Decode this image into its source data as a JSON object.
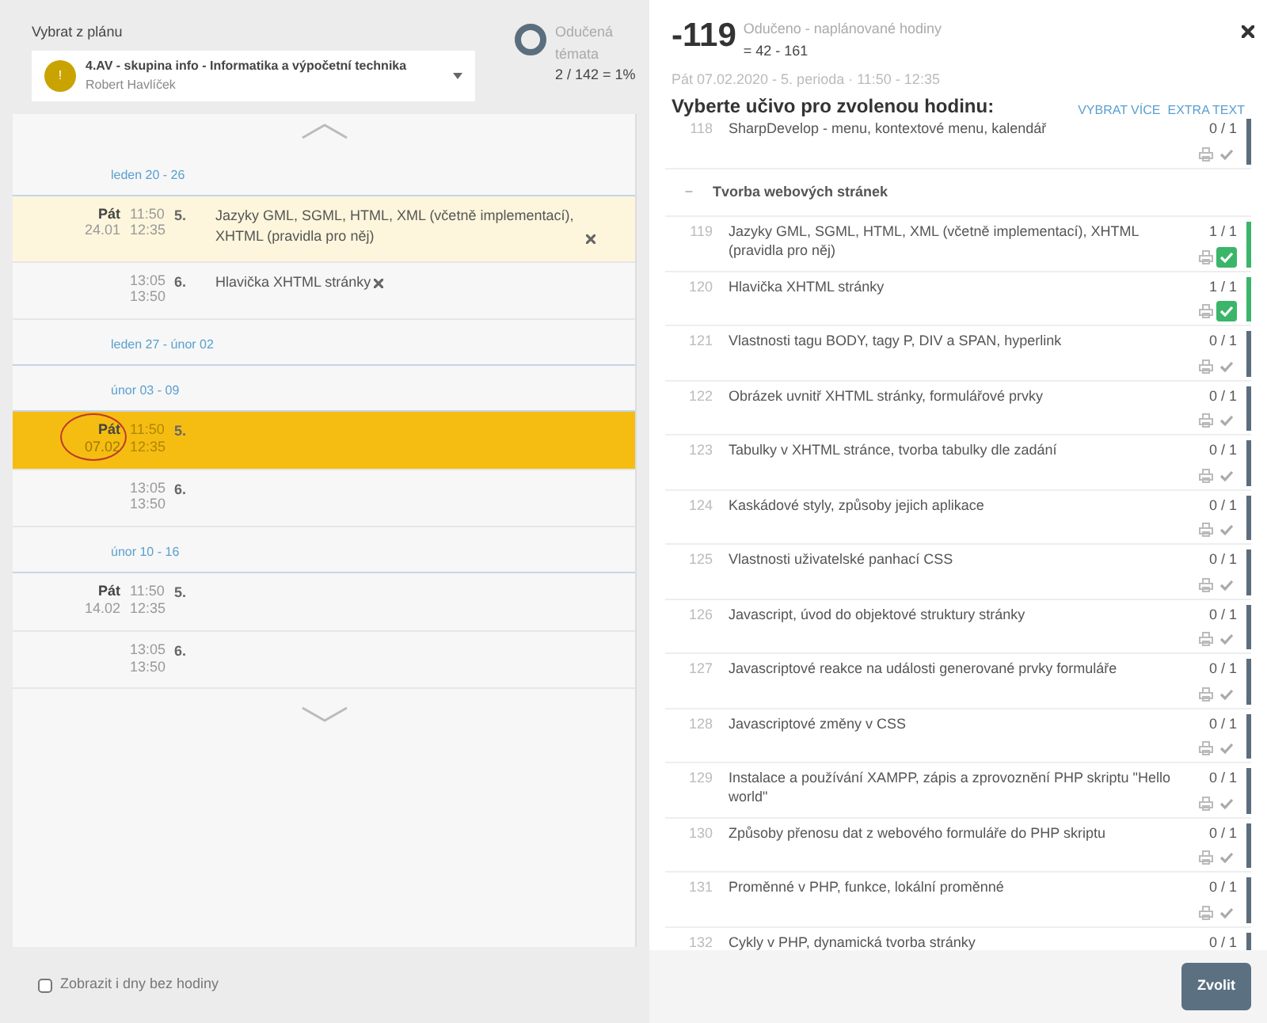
{
  "left": {
    "plan_label": "Vybrat z plánu",
    "plan_select": {
      "badge": "!",
      "title": "4.AV - skupina info - Informatika a výpočetní technika",
      "teacher": "Robert Havlíček"
    },
    "progress": {
      "label": "Odučená témata",
      "value": "2 / 142 = 1%"
    },
    "weeks": [
      {
        "label": "leden 20 - 26",
        "lessons": [
          {
            "day": "Pát",
            "date": "24.01",
            "start": "11:50",
            "end": "12:35",
            "period": "5.",
            "topic": "Jazyky GML, SGML, HTML, XML (včetně implementací), XHTML (pravidla pro něj)",
            "selected": false,
            "highlighted": true,
            "circled": false
          },
          {
            "start": "13:05",
            "end": "13:50",
            "period": "6.",
            "topic": "Hlavička XHTML stránky",
            "selected": false,
            "highlighted": false,
            "circled": false
          }
        ]
      },
      {
        "label": "leden 27 - únor 02"
      },
      {
        "label": "únor 03 - 09",
        "lessons": [
          {
            "day": "Pát",
            "date": "07.02",
            "start": "11:50",
            "end": "12:35",
            "period": "5.",
            "selected": true,
            "highlighted": false,
            "circled": true
          },
          {
            "start": "13:05",
            "end": "13:50",
            "period": "6.",
            "selected": false,
            "highlighted": false,
            "circled": false
          }
        ]
      },
      {
        "label": "únor 10 - 16",
        "lessons": [
          {
            "day": "Pát",
            "date": "14.02",
            "start": "11:50",
            "end": "12:35",
            "period": "5.",
            "selected": false,
            "highlighted": false,
            "circled": false
          },
          {
            "start": "13:05",
            "end": "13:50",
            "period": "6.",
            "selected": false,
            "highlighted": false,
            "circled": false
          }
        ]
      }
    ],
    "show_empty_days": {
      "label": "Zobrazit i dny bez hodiny",
      "checked": false
    }
  },
  "right": {
    "balance": "-119",
    "balance_label": "Odučeno - naplánované hodiny",
    "balance_formula": "= 42 - 161",
    "lesson_info": "Pát 07.02.2020 - 5. perioda · 11:50 - 12:35",
    "heading": "Vyberte učivo pro zvolenou hodinu:",
    "links": [
      "VYBRAT VÍCE",
      "EXTRA TEXT"
    ],
    "topics": [
      {
        "kind": "topic",
        "number": "118",
        "text": "SharpDevelop - menu, kontextové menu, kalendář",
        "count": "0 / 1",
        "done": false
      },
      {
        "kind": "section",
        "toggle": "−",
        "text": "Tvorba webových stránek"
      },
      {
        "kind": "topic",
        "number": "119",
        "text": "Jazyky GML, SGML, HTML, XML (včetně implementací), XHTML (pravidla pro něj)",
        "count": "1 / 1",
        "done": true
      },
      {
        "kind": "topic",
        "number": "120",
        "text": "Hlavička XHTML stránky",
        "count": "1 / 1",
        "done": true
      },
      {
        "kind": "topic",
        "number": "121",
        "text": "Vlastnosti tagu BODY, tagy P, DIV a SPAN, hyperlink",
        "count": "0 / 1",
        "done": false
      },
      {
        "kind": "topic",
        "number": "122",
        "text": "Obrázek uvnitř XHTML stránky, formulářové prvky",
        "count": "0 / 1",
        "done": false
      },
      {
        "kind": "topic",
        "number": "123",
        "text": "Tabulky v XHTML stránce, tvorba tabulky dle zadání",
        "count": "0 / 1",
        "done": false
      },
      {
        "kind": "topic",
        "number": "124",
        "text": "Kaskádové styly, způsoby jejich aplikace",
        "count": "0 / 1",
        "done": false
      },
      {
        "kind": "topic",
        "number": "125",
        "text": "Vlastnosti uživatelské panhací CSS",
        "count": "0 / 1",
        "done": false
      },
      {
        "kind": "topic",
        "number": "126",
        "text": "Javascript, úvod do objektové struktury stránky",
        "count": "0 / 1",
        "done": false
      },
      {
        "kind": "topic",
        "number": "127",
        "text": "Javascriptové reakce na události generované prvky formuláře",
        "count": "0 / 1",
        "done": false
      },
      {
        "kind": "topic",
        "number": "128",
        "text": "Javascriptové změny v CSS",
        "count": "0 / 1",
        "done": false
      },
      {
        "kind": "topic",
        "number": "129",
        "text": "Instalace a používání XAMPP, zápis a zprovoznění PHP skriptu \"Hello world\"",
        "count": "0 / 1",
        "done": false
      },
      {
        "kind": "topic",
        "number": "130",
        "text": "Způsoby přenosu dat z webového formuláře do PHP skriptu",
        "count": "0 / 1",
        "done": false
      },
      {
        "kind": "topic",
        "number": "131",
        "text": "Proměnné v PHP, funkce, lokální proměnné",
        "count": "0 / 1",
        "done": false
      },
      {
        "kind": "topic",
        "number": "132",
        "text": "Cykly v PHP, dynamická tvorba stránky",
        "count": "0 / 1",
        "done": false
      }
    ],
    "submit": "Zvolit"
  }
}
